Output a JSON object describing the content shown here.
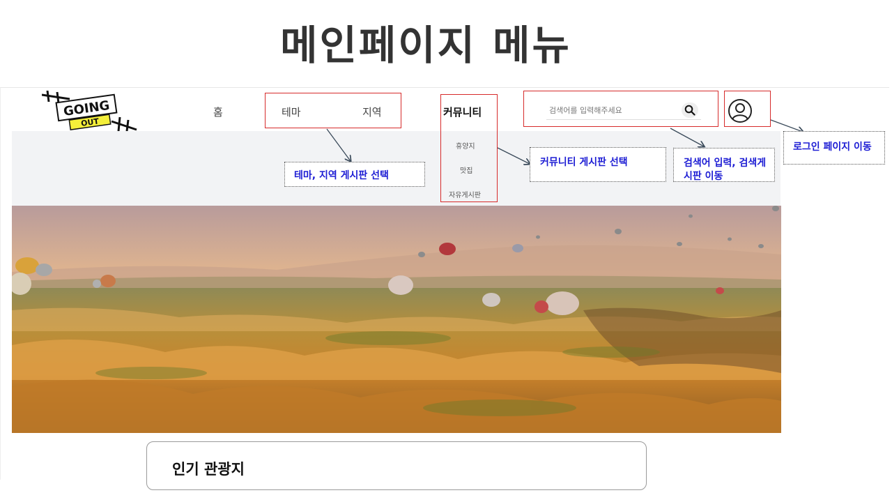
{
  "slide": {
    "title": "메인페이지 메뉴"
  },
  "logo": {
    "line1": "GOING",
    "line2": "OUT"
  },
  "nav": {
    "home": "홈",
    "theme": "테마",
    "region": "지역",
    "community": "커뮤니티"
  },
  "community_submenu": [
    "휴양지",
    "맛집",
    "자유게시판"
  ],
  "search": {
    "placeholder": "검색어를 입력해주세요"
  },
  "card": {
    "title": "인기 관광지"
  },
  "annotations": {
    "theme_region": "테마, 지역 게시판 선택",
    "community": "커뮤니티 게시판 선택",
    "search": "검색어 입력, 검색게시판 이동",
    "login": "로그인 페이지 이동"
  },
  "colors": {
    "highlight": "#d62a2a",
    "annotation_text": "#1d1dd4",
    "band": "#f2f3f5",
    "logo_tag": "#f4ef3a"
  },
  "icons": [
    "search-icon",
    "user-icon",
    "arrow-icon"
  ]
}
